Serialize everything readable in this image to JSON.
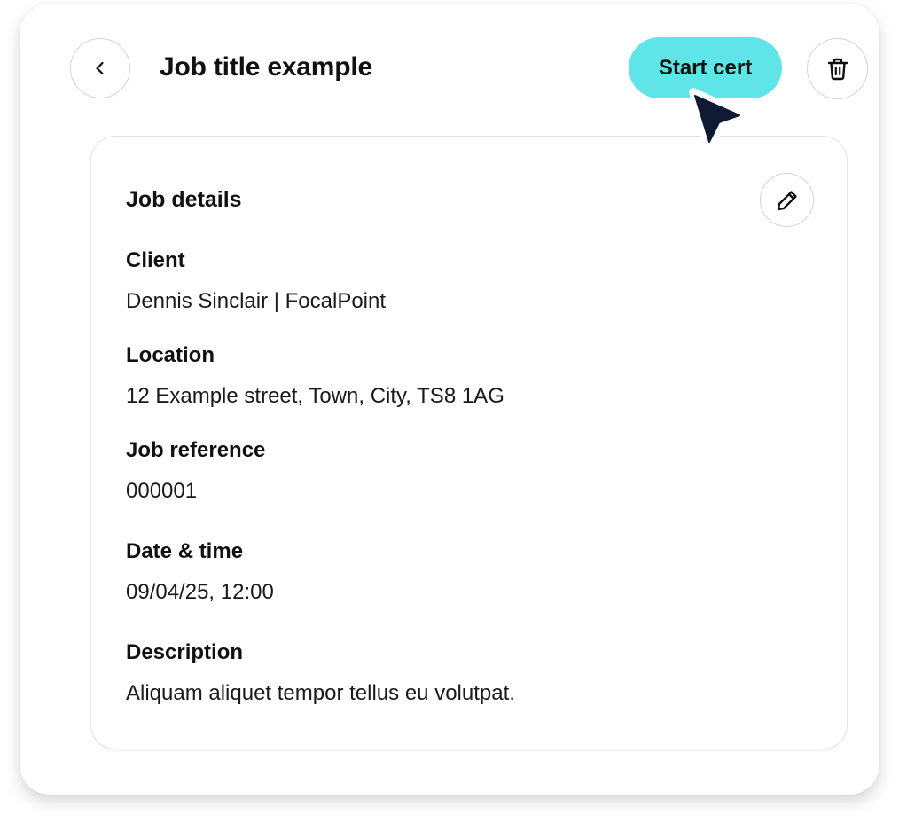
{
  "colors": {
    "accent": "#5fe4e8",
    "text": "#111111",
    "border": "#d4d4d8",
    "cursor": "#0f1a33"
  },
  "header": {
    "back_icon": "chevron-left-icon",
    "title": "Job title example",
    "start_cert_label": "Start cert",
    "delete_icon": "trash-icon"
  },
  "card": {
    "title": "Job details",
    "edit_icon": "pencil-icon",
    "fields": [
      {
        "label": "Client",
        "value": "Dennis Sinclair | FocalPoint"
      },
      {
        "label": "Location",
        "value": "12 Example street, Town, City, TS8 1AG"
      },
      {
        "label": "Job reference",
        "value": "000001"
      },
      {
        "label": "Date & time",
        "value": "09/04/25, 12:00"
      },
      {
        "label": "Description",
        "value": "Aliquam aliquet tempor tellus eu volutpat."
      }
    ]
  }
}
